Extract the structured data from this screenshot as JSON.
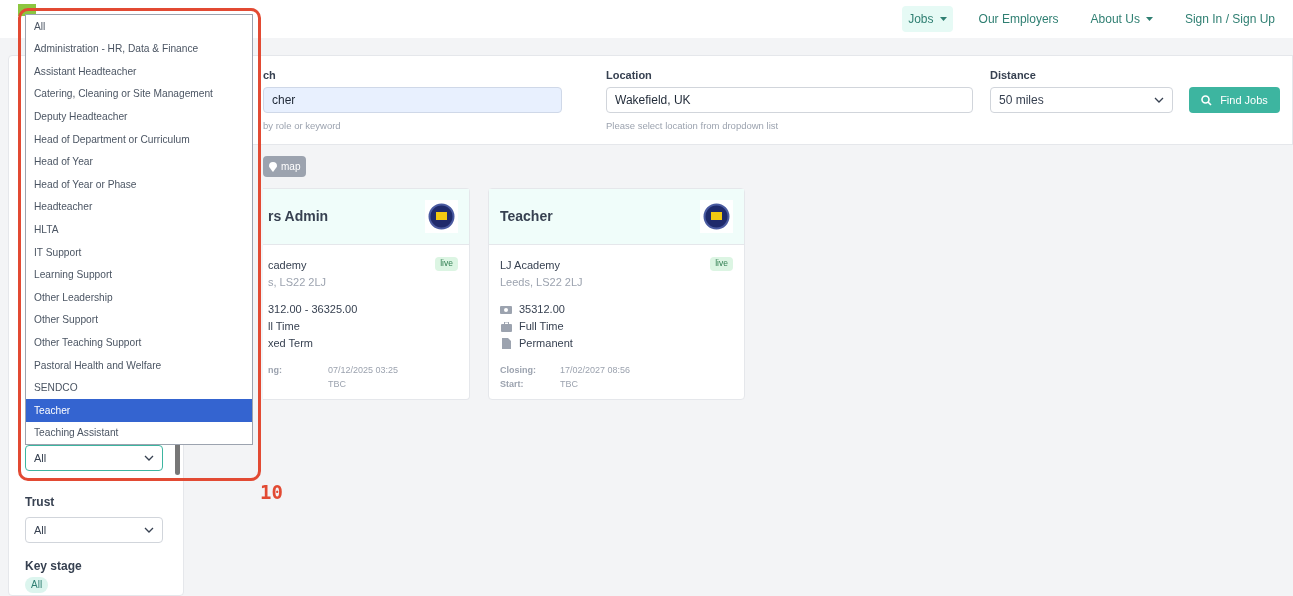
{
  "nav": {
    "items": [
      {
        "label": "Jobs",
        "dropdown": true,
        "selected": true
      },
      {
        "label": "Our Employers",
        "dropdown": false,
        "selected": false
      },
      {
        "label": "About Us",
        "dropdown": true,
        "selected": false
      },
      {
        "label": "Sign In / Sign Up",
        "dropdown": false,
        "selected": false
      }
    ]
  },
  "search": {
    "fields": [
      {
        "label": "ch",
        "value": "cher",
        "hint": "by role or keyword",
        "kind": "text",
        "highlighted": true
      },
      {
        "label": "Location",
        "value": "Wakefield, UK",
        "hint": "Please select location from dropdown list",
        "kind": "text",
        "highlighted": false
      },
      {
        "label": "Distance",
        "value": "50 miles",
        "kind": "select"
      }
    ],
    "button": "Find Jobs"
  },
  "map_button": "map",
  "cards": [
    {
      "title": "rs Admin",
      "status": "live",
      "company": "cademy",
      "location": "s, LS22 2LJ",
      "details": [
        {
          "text": "312.00 - 36325.00",
          "kind": "clipped"
        },
        {
          "text": "ll Time",
          "kind": "clipped"
        },
        {
          "text": "xed Term",
          "kind": "clipped"
        }
      ],
      "closing_label": "ng:",
      "closing": "07/12/2025 03:25",
      "start": "TBC"
    },
    {
      "title": "Teacher",
      "status": "live",
      "company": "LJ Academy",
      "location": "Leeds, LS22 2LJ",
      "details": [
        {
          "text": "35312.00",
          "kind": "salary"
        },
        {
          "text": "Full Time",
          "kind": "hours"
        },
        {
          "text": "Permanent",
          "kind": "contract"
        }
      ],
      "closing_label": "Closing:",
      "closing": "17/02/2027 08:56",
      "start_label": "Start:",
      "start": "TBC"
    }
  ],
  "sidebar": {
    "role_select": {
      "value": "All",
      "focused": true
    },
    "trust": {
      "label": "Trust",
      "value": "All"
    },
    "key_stage": {
      "label": "Key stage",
      "chips": [
        {
          "label": "All",
          "selected": true
        }
      ]
    }
  },
  "dropdown": {
    "options": [
      {
        "label": "All",
        "selected": false
      },
      {
        "label": "Administration - HR, Data & Finance",
        "selected": false
      },
      {
        "label": "Assistant Headteacher",
        "selected": false
      },
      {
        "label": "Catering, Cleaning or Site Management",
        "selected": false
      },
      {
        "label": "Deputy Headteacher",
        "selected": false
      },
      {
        "label": "Head of Department or Curriculum",
        "selected": false
      },
      {
        "label": "Head of Year",
        "selected": false
      },
      {
        "label": "Head of Year or Phase",
        "selected": false
      },
      {
        "label": "Headteacher",
        "selected": false
      },
      {
        "label": "HLTA",
        "selected": false
      },
      {
        "label": "IT Support",
        "selected": false
      },
      {
        "label": "Learning Support",
        "selected": false
      },
      {
        "label": "Other Leadership",
        "selected": false
      },
      {
        "label": "Other Support",
        "selected": false
      },
      {
        "label": "Other Teaching Support",
        "selected": false
      },
      {
        "label": "Pastoral Health and Welfare",
        "selected": false
      },
      {
        "label": "SENDCO",
        "selected": false
      },
      {
        "label": "Teacher",
        "selected": true
      },
      {
        "label": "Teaching Assistant",
        "selected": false
      }
    ]
  },
  "annotation": {
    "label": "10"
  }
}
